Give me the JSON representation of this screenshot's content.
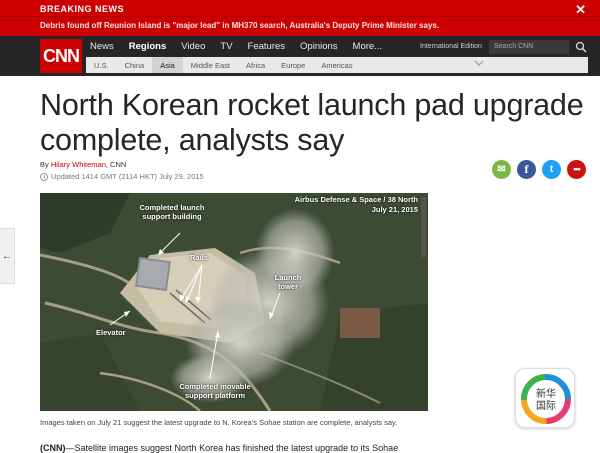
{
  "breaking": {
    "label": "BREAKING NEWS",
    "headline": "Debris found off Reunion Island is \"major lead\" in MH370 search, Australia's Deputy Prime Minister says.",
    "close_glyph": "✕"
  },
  "nav": {
    "logo": "CNN",
    "items": [
      "News",
      "Regions",
      "Video",
      "TV",
      "Features",
      "Opinions",
      "More..."
    ],
    "edition": "International Edition",
    "search_placeholder": "Search CNN",
    "subnav": [
      "U.S.",
      "China",
      "Asia",
      "Middle East",
      "Africa",
      "Europe",
      "Americas"
    ]
  },
  "article": {
    "headline": "North Korean rocket launch pad upgrade complete, analysts say",
    "by": "By",
    "author": "Hilary Whiteman",
    "source": ", CNN",
    "updated": "Updated 1414 GMT (2114 HKT) July 29, 2015",
    "caption": "Images taken on July 21 suggest the latest upgrade to N. Korea's Sohae station are complete, analysts say.",
    "body_lead": "(CNN)",
    "body": "—Satellite images suggest North Korea has finished the latest upgrade to its Sohae"
  },
  "image": {
    "credit_line1": "Airbus Defense & Space / 38 North",
    "credit_line2": "July 21, 2015",
    "labels": {
      "building": "Completed launch support building",
      "rails": "Rails",
      "tower": "Launch tower",
      "elevator": "Elevator",
      "platform": "Completed movable support platform"
    }
  },
  "share": {
    "email": "✉",
    "facebook": "f",
    "twitter": "t",
    "more": "•••"
  },
  "side_arrow": "←",
  "watermark": {
    "text_top": "新华",
    "text_bottom": "国际"
  },
  "colors": {
    "brand_red": "#cc0000",
    "nav_dark": "#262626",
    "email_green": "#7ab648",
    "facebook_blue": "#3b5998",
    "twitter_blue": "#1da1f2"
  }
}
